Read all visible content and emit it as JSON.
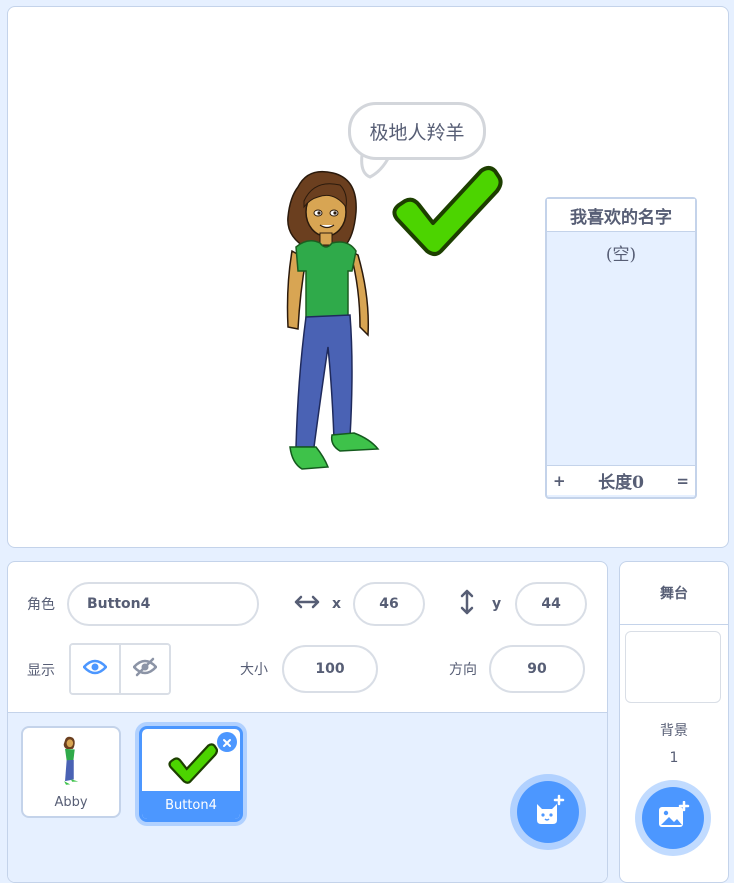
{
  "stage": {
    "speech_bubble": "极地人羚羊",
    "list_monitor": {
      "title": "我喜欢的名字",
      "empty_text": "(空)",
      "add_label": "+",
      "length_label": "长度0",
      "resize_label": "="
    }
  },
  "sprite_info": {
    "sprite_label": "角色",
    "sprite_name": "Button4",
    "x_label": "x",
    "x_value": "46",
    "y_label": "y",
    "y_value": "44",
    "show_label": "显示",
    "size_label": "大小",
    "size_value": "100",
    "direction_label": "方向",
    "direction_value": "90"
  },
  "sprites": [
    {
      "name": "Abby",
      "selected": false
    },
    {
      "name": "Button4",
      "selected": true
    }
  ],
  "stage_pane": {
    "title": "舞台",
    "backdrop_label": "背景",
    "backdrop_count": "1"
  },
  "colors": {
    "accent": "#4c97ff",
    "check_green": "#4cd400",
    "panel_bg": "#e6f0ff",
    "text": "#575e75"
  },
  "icons": {
    "visible": "eye-icon",
    "hidden": "eye-slash-icon",
    "x": "horizontal-arrows-icon",
    "y": "vertical-arrows-icon",
    "add_sprite": "cat-plus-icon",
    "add_backdrop": "image-plus-icon",
    "delete": "close-icon"
  }
}
